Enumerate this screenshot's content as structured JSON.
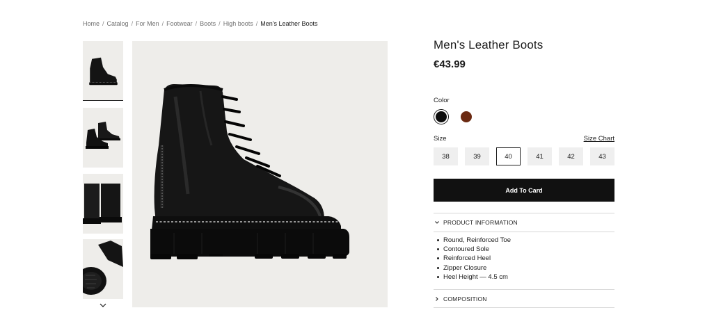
{
  "breadcrumb": {
    "items": [
      "Home",
      "Catalog",
      "For Men",
      "Footwear",
      "Boots",
      "High boots"
    ],
    "current": "Men's Leather Boots",
    "separator": "/"
  },
  "gallery": {
    "thumbnails": [
      "boot-side-view",
      "boots-pair-view",
      "boots-back-view",
      "boot-sole-view"
    ],
    "active_thumbnail": 0,
    "scroll_icon": "chevron-down-icon",
    "main_image": "black-leather-lace-up-boot"
  },
  "product": {
    "title": "Men's Leather Boots",
    "price": "€43.99"
  },
  "color": {
    "label": "Color",
    "options": [
      {
        "name": "Black",
        "hex": "#0d0d0d"
      },
      {
        "name": "Brown",
        "hex": "#6b2a12"
      }
    ],
    "selected": 0
  },
  "size": {
    "label": "Size",
    "chart_label": "Size Chart",
    "options": [
      "38",
      "39",
      "40",
      "41",
      "42",
      "43"
    ],
    "selected": "40"
  },
  "cart": {
    "button_label": "Add To Card"
  },
  "accordion": {
    "product_information": {
      "label": "PRODUCT INFORMATION",
      "expanded": true,
      "items": [
        "Round, Reinforced Toe",
        "Contoured Sole",
        "Reinforced Heel",
        "Zipper Closure",
        "Heel Height — 4.5 cm"
      ]
    },
    "composition": {
      "label": "COMPOSITION",
      "expanded": false
    }
  },
  "colors": {
    "accent": "#111111",
    "image_background": "#eeedea",
    "size_button_bg": "#efefef"
  }
}
